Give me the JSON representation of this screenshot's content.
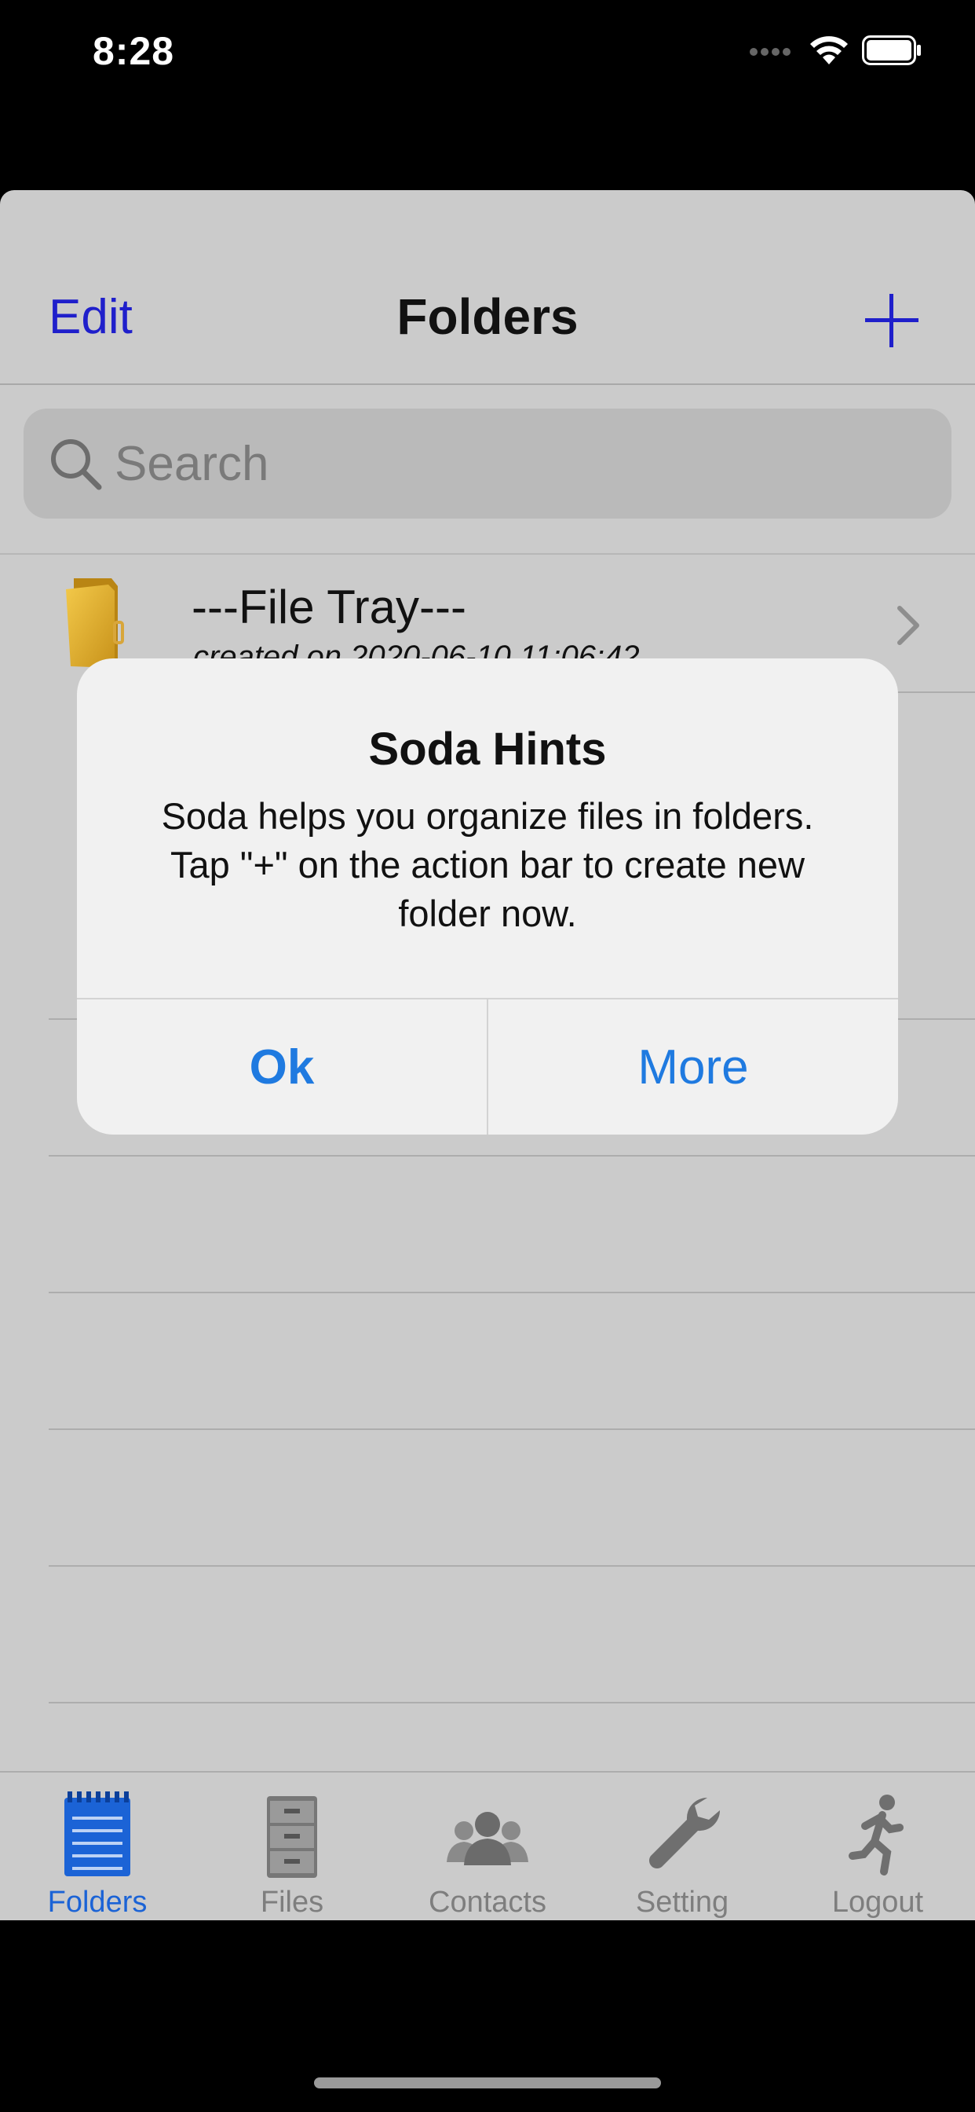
{
  "status_bar": {
    "time": "8:28"
  },
  "nav": {
    "edit_label": "Edit",
    "title": "Folders",
    "add_icon": "plus-icon"
  },
  "search": {
    "placeholder": "Search"
  },
  "folders": [
    {
      "name": "---File Tray---",
      "created": "created on 2020-06-10 11:06:42"
    }
  ],
  "alert": {
    "title": "Soda Hints",
    "message": "Soda helps you organize files in folders. Tap \"+\" on the action bar to create new folder now.",
    "ok_label": "Ok",
    "more_label": "More"
  },
  "tabs": [
    {
      "label": "Folders",
      "icon": "notepad-icon",
      "active": true
    },
    {
      "label": "Files",
      "icon": "file-cabinet-icon",
      "active": false
    },
    {
      "label": "Contacts",
      "icon": "people-icon",
      "active": false
    },
    {
      "label": "Setting",
      "icon": "wrench-icon",
      "active": false
    },
    {
      "label": "Logout",
      "icon": "running-man-icon",
      "active": false
    }
  ],
  "colors": {
    "accent": "#1f7ae0",
    "nav_tint": "#1f1fcb",
    "active_tab": "#1b63d6",
    "background": "#cbcbcb"
  }
}
